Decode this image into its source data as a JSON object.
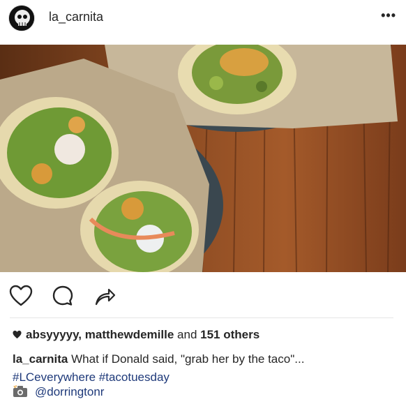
{
  "post": {
    "username": "la_carnita",
    "more_icon": "more-horizontal-icon"
  },
  "actions": {
    "like_icon": "heart-outline-icon",
    "comment_icon": "comment-bubble-icon",
    "share_icon": "share-arrow-icon"
  },
  "likes": {
    "users": "absyyyyy, matthewdemille",
    "and_text": "and",
    "others": "151 others"
  },
  "caption": {
    "username": "la_carnita",
    "text": "What if Donald said, \"grab her by the taco\"...",
    "hashtags": "#LCeverywhere #tacotuesday"
  },
  "tagged": {
    "user": "@dorringtonr"
  },
  "colors": {
    "link": "#1f3a7a",
    "text": "#262626"
  }
}
